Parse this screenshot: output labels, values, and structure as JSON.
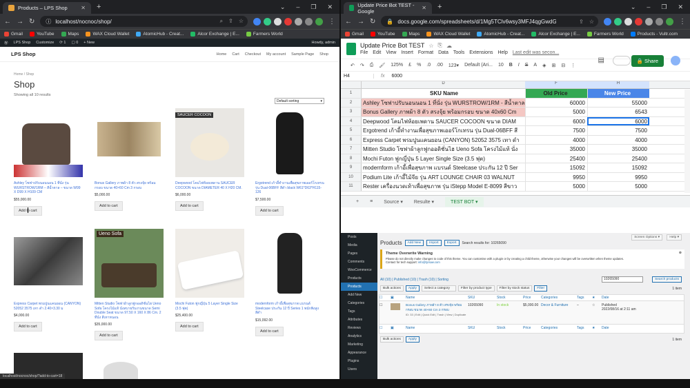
{
  "left": {
    "tab_title": "Products – LPS Shop",
    "url": "localhost/nocnoc/shop/",
    "bookmarks": [
      "Gmail",
      "YouTube",
      "Maps",
      "WAX Cloud Wallet",
      "AtomicHub - Creat...",
      "Alcor Exchange | E...",
      "Farmers World"
    ],
    "wpbar": [
      "LPS Shop",
      "Customize",
      "1",
      "0",
      "+ New"
    ],
    "howdy": "Howdy, admin",
    "site_title": "LPS Shop",
    "nav": [
      "Home",
      "Cart",
      "Checkout",
      "My account",
      "Sample Page",
      "Shop"
    ],
    "breadcrumb": "Home / Shop",
    "heading": "Shop",
    "showing": "Showing all 10 results",
    "sort": "Default sorting",
    "add_to_cart": "Add to cart",
    "status_url": "localhost/nocnoc/shop/?add-to-cart=18",
    "products": [
      {
        "name": "Ashley โซฟาปรับนอนนอน 1 ที่นั่ง รุ่น WURSTROW/1RM – สีน้ำตาล – ขนาด W99 X D99 X H109 CM",
        "price": "$55,000.00"
      },
      {
        "name": "Bonus Gallery ภาพผ้า 8 ตัว สรงจุ้ย พร้อมกรอบ ขนาด 40×60 Cm 3 กรอบ",
        "price": "$5,000.00"
      },
      {
        "name": "Deepwood โคมไฟห้อยเพดาน SAUCER COCOON ขนาด DIAMETER 40 X H20 CM.",
        "price": "$6,000.00",
        "label": "SAUCER COCOON"
      },
      {
        "name": "Ergotrend เก้าอี้ทำงานเพื่อสุขภาพเออร์โกเทรน รุ่น Dual-06BFF สีดำ black W61*D63*H115-126",
        "price": "$7,500.00"
      },
      {
        "name": "Express Carpet พรมปูนแคนยอน (CANYON) 52052 3575 เทา ดำ 2.40×3.30 ม",
        "price": "$4,000.00"
      },
      {
        "name": "Mitten Studio โซฟาผ้าลูกฟูกออดิชั่นไฮ Ueno Sofa โครงไม้แท้ นั่งสบายรับงานขนาด Semi Double Seat ขนาด 97.50 X 160 X 86 Cm. 2 ที่นั่ง สีเทาหนอน",
        "price": "$35,000.00",
        "label": "Ueno Sofa"
      },
      {
        "name": "Mochi Futon ฟูกญี่ปุ่น 5 Layer Single Size (3.5 ฟุต)",
        "price": "$25,400.00"
      },
      {
        "name": "modernform เก้าอี้เพื่อสุขภาพ แบรนด์ Steelcase ประกัน 12 ปี Series 1 พนักพิงสูง สีดำ",
        "price": "$15,092.00"
      }
    ]
  },
  "right": {
    "tab_title": "Update Price Bot TEST - Google",
    "url": "docs.google.com/spreadsheets/d/1Mg5TClv6wsy3MFJ4qgGwdGJTEEJmnU0A...",
    "bookmarks": [
      "Gmail",
      "YouTube",
      "Maps",
      "WAX Cloud Wallet",
      "AtomicHub - Creat...",
      "Alcor Exchange | E...",
      "Farmers World",
      "Products - Vultr.com"
    ],
    "doc_title": "Update Price Bot TEST",
    "menu": [
      "File",
      "Edit",
      "View",
      "Insert",
      "Format",
      "Data",
      "Tools",
      "Extensions",
      "Help"
    ],
    "last_edit": "Last edit was secon...",
    "share": "Share",
    "zoom": "125%",
    "font": "Default (Ari...",
    "font_size": "10",
    "cell_ref": "H4",
    "formula": "6000",
    "col_headers": [
      "D",
      "F",
      "H"
    ],
    "table": {
      "headers": [
        "SKU Name",
        "Old Price",
        "New Price"
      ],
      "rows": [
        [
          "Ashley โซฟาปรับนอนนอน 1 ที่นั่ง รุ่น WURSTROW/1RM - สีน้ำตาล",
          "60000",
          "55000"
        ],
        [
          "Bonus Gallery ภาพผ้า 8 ตัว สรงจุ้ย พร้อมกรอบ ขนาด 40x60 Cm",
          "5000",
          "6543"
        ],
        [
          "Deepwood โคมไฟห้อยเพดาน SAUCER COCOON ขนาด DIAM",
          "6000",
          "6000"
        ],
        [
          "Ergotrend เก้าอี้ทำงานเพื่อสุขภาพเออร์โกเทรน รุ่น Dual-06BFF สี",
          "7500",
          "7500"
        ],
        [
          "Express Carpet พรมปูนแคนยอน (CANYON) 52052 3575 เทา ดำ",
          "4000",
          "4000"
        ],
        [
          "Mitten Studio โซฟาผ้าลูกฟูกออดิชั่นไฮ Ueno Sofa โครงไม้แท้ นั่ง",
          "35000",
          "35000"
        ],
        [
          "Mochi Futon ฟูกญี่ปุ่น 5 Layer Single Size (3.5 ฟุต)",
          "25400",
          "25400"
        ],
        [
          "modernform เก้าอี้เพื่อสุขภาพ แบรนด์ Steelcase ประกัน 12 ปี Ser",
          "15092",
          "15092"
        ],
        [
          "Podium Lite เก้าอี้ไม้จีย รุ่น ART LOUNGE CHAIR 03 WALNUT",
          "9950",
          "9950"
        ],
        [
          "Rester เครื่องนวดเท้าเพื่อสุขภาพ รุ่น iStepp Model E-8099 สีขาว",
          "5000",
          "5000"
        ]
      ]
    },
    "sheet_tabs": [
      "Source",
      "Resulte",
      "TEST BOT"
    ],
    "wp": {
      "side": [
        "Posts",
        "Media",
        "Pages",
        "Comments",
        "WooCommerce",
        "Products",
        "Products",
        "Add New",
        "Categories",
        "Tags",
        "Attributes",
        "Reviews",
        "Analytics",
        "Marketing",
        "Appearance",
        "Plugins",
        "Users"
      ],
      "title": "Products",
      "buttons": [
        "Add New",
        "Import",
        "Export"
      ],
      "search_results": "Search results for: 10265090",
      "screen_options": "Screen Options ▾",
      "help": "Help ▾",
      "warn_title": "Theme Overwrite Warning",
      "warn_text": "Please do not directly make changes to code of this theme. You can customise with a plugin or by creating a child theme, otherwise your changes will be overwritten when theme updates.",
      "warn_text2": "Contact for tech support: ",
      "warn_link": "info@lyrsaw.com",
      "filters": "All (10) | Published (10) | Trash (10) | Sorting",
      "bulk": "Bulk actions",
      "apply": "Apply",
      "cat": "Select a category",
      "ptype": "Filter by product type",
      "stock": "Filter by stock status",
      "filter": "Filter",
      "search_val": "10265090",
      "search_btn": "Search products",
      "count": "1 item",
      "cols": [
        "Name",
        "SKU",
        "Stock",
        "Price",
        "Categories",
        "Tags",
        "Date"
      ],
      "row": {
        "name": "Bonus Gallery ภาพผ้า 8 ตัว สรงจุ้ย พร้อมกรอบ ขนาด 40×60 Cm 3 กรอบ",
        "meta": "ID: 33 | Edit | Quick Edit | Trash | View | Duplicate",
        "sku": "10265090",
        "stock": "In stock",
        "price": "$5,000.00",
        "cat": "Decor & Furniture",
        "tags": "–",
        "date1": "Published",
        "date2": "2022/08/16 at 2:11 am"
      }
    }
  }
}
